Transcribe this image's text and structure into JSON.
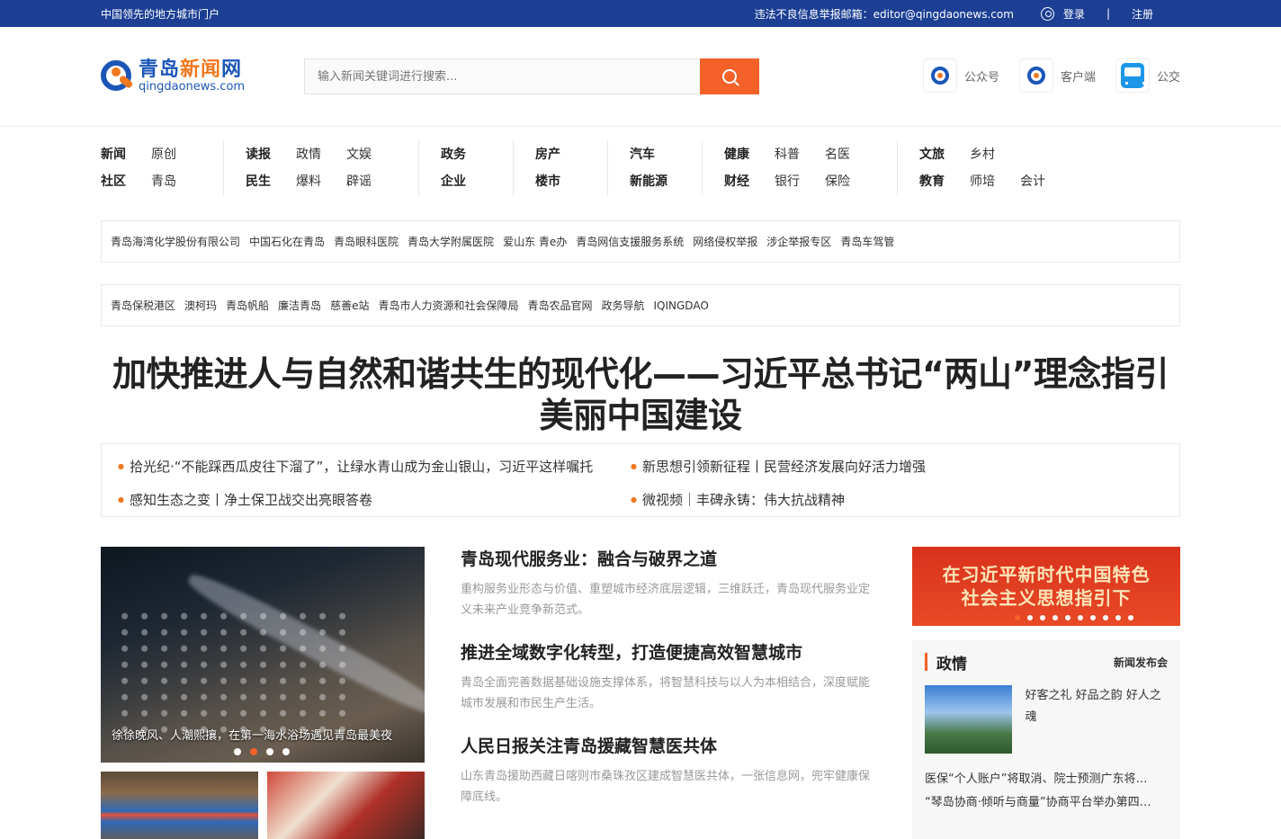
{
  "topbar": {
    "slogan": "中国领先的地方城市门户",
    "report": "违法不良信息举报邮箱：editor@qingdaonews.com",
    "login": "登录",
    "sep": "|",
    "register": "注册"
  },
  "logo": {
    "cn_main": "青岛",
    "cn_accent": "新闻",
    "cn_end": "网",
    "en": "qingdaonews.com"
  },
  "search": {
    "placeholder": "输入新闻关键词进行搜索..."
  },
  "quick": [
    {
      "label": "公众号"
    },
    {
      "label": "客户端"
    },
    {
      "label": "公交"
    }
  ],
  "nav": [
    {
      "items": [
        "新闻",
        "社区",
        "原创",
        "青岛"
      ]
    },
    {
      "items": [
        "读报",
        "民生",
        "政情",
        "爆料",
        "文娱",
        "辟谣"
      ]
    },
    {
      "items": [
        "政务",
        "企业"
      ]
    },
    {
      "items": [
        "房产",
        "楼市"
      ]
    },
    {
      "items": [
        "汽车",
        "新能源"
      ]
    },
    {
      "items": [
        "健康",
        "财经",
        "科普",
        "银行",
        "名医",
        "保险"
      ]
    },
    {
      "items": [
        "文旅",
        "教育",
        "乡村",
        "师培",
        "",
        "会计"
      ]
    }
  ],
  "links1": [
    "青岛海湾化学股份有限公司",
    "中国石化在青岛",
    "青岛眼科医院",
    "青岛大学附属医院",
    "爱山东 青e办",
    "青岛网信支援服务系统",
    "网络侵权举报",
    "涉企举报专区",
    "青岛车驾管"
  ],
  "links2": [
    "青岛保税港区",
    "澳柯玛",
    "青岛帆船",
    "廉洁青岛",
    "慈善e站",
    "青岛市人力资源和社会保障局",
    "青岛农品官网",
    "政务导航",
    "IQINGDAO"
  ],
  "headline": "加快推进人与自然和谐共生的现代化——习近平总书记“两山”理念指引美丽中国建设",
  "subnews": [
    "拾光纪·“不能踩西瓜皮往下溜了”，让绿水青山成为金山银山，习近平这样嘱托",
    "新思想引领新征程丨民营经济发展向好活力增强",
    "感知生态之变丨净土保卫战交出亮眼答卷",
    "微视频｜丰碑永铸：伟大抗战精神"
  ],
  "slider": {
    "caption": "徐徐晚风、人潮熙攘，在第一海水浴场遇见青岛最美夜",
    "active_dot": 2,
    "dot_count": 4
  },
  "articles": [
    {
      "title": "青岛现代服务业：融合与破界之道",
      "summary": "重构服务业形态与价值、重塑城市经济底层逻辑，三维跃迁，青岛现代服务业定义未来产业竞争新范式。"
    },
    {
      "title": "推进全域数字化转型，打造便捷高效智慧城市",
      "summary": "青岛全面完善数据基础设施支撑体系，将智慧科技与以人为本相结合，深度赋能城市发展和市民生产生活。"
    },
    {
      "title": "人民日报关注青岛援藏智慧医共体",
      "summary": "山东青岛援助西藏日喀则市桑珠孜区建成智慧医共体，一张信息网，兜牢健康保障底线。"
    }
  ],
  "banner": {
    "line1": "在习近平新时代中国特色",
    "line2": "社会主义思想指引下"
  },
  "panel": {
    "title": "政情",
    "more": "新闻发布会",
    "feature": "好客之礼 好品之韵 好人之魂",
    "list": [
      "医保“个人账户”将取消、院士预测广东将…",
      "“琴岛协商·倾听与商量”协商平台举办第四…"
    ]
  },
  "colors": {
    "brand_blue": "#1c3f94",
    "accent_orange": "#f4622a"
  }
}
